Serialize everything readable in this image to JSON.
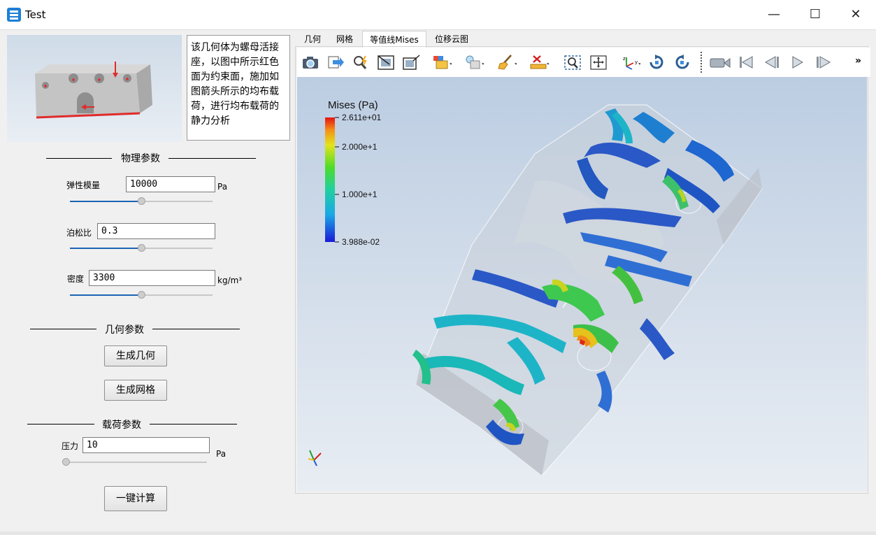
{
  "window": {
    "title": "Test",
    "minimize_symbol": "—",
    "maximize_symbol": "☐",
    "close_symbol": "✕"
  },
  "description": "该几何体为螺母活接座，以图中所示红色面为约束面，施加如图箭头所示的均布载荷，进行均布载荷的静力分析",
  "sections": {
    "physics_title": "物理参数",
    "geometry_title": "几何参数",
    "load_title": "载荷参数"
  },
  "physics": {
    "elastic_label": "弹性模量",
    "elastic_value": "10000",
    "elastic_unit": "Pa",
    "elastic_slider": 0.5,
    "poisson_label": "泊松比",
    "poisson_value": "0.3",
    "poisson_slider": 0.5,
    "density_label": "密度",
    "density_value": "3300",
    "density_unit": "kg/m³",
    "density_slider": 0.5
  },
  "geometry": {
    "gen_geometry_label": "生成几何",
    "gen_mesh_label": "生成网格"
  },
  "load": {
    "pressure_label": "压力",
    "pressure_value": "10",
    "pressure_unit": "Pa",
    "pressure_slider": 0.0
  },
  "calculate_label": "一键计算",
  "tabs": [
    {
      "label": "几何",
      "active": false
    },
    {
      "label": "网格",
      "active": false
    },
    {
      "label": "等值线Mises",
      "active": true
    },
    {
      "label": "位移云图",
      "active": false
    }
  ],
  "toolbar": {
    "icons": [
      "camera-icon",
      "export-icon",
      "pick-icon",
      "zoom-fit-icon",
      "zoom-box-icon",
      "display-mode-icon",
      "light-icon",
      "clear-icon",
      "measure-icon",
      "zoom-select-icon",
      "pan-icon",
      "axes-icon",
      "rotate-cw-icon",
      "rotate-ccw-icon",
      "video-icon",
      "first-frame-icon",
      "prev-frame-icon",
      "next-frame-icon",
      "last-frame-icon"
    ],
    "overflow_symbol": "»"
  },
  "colorbar": {
    "title": "Mises (Pa)",
    "max_label": "2.611e+01",
    "tick_high": "2.000e+1",
    "tick_mid": "1.000e+1",
    "min_label": "3.988e-02"
  }
}
